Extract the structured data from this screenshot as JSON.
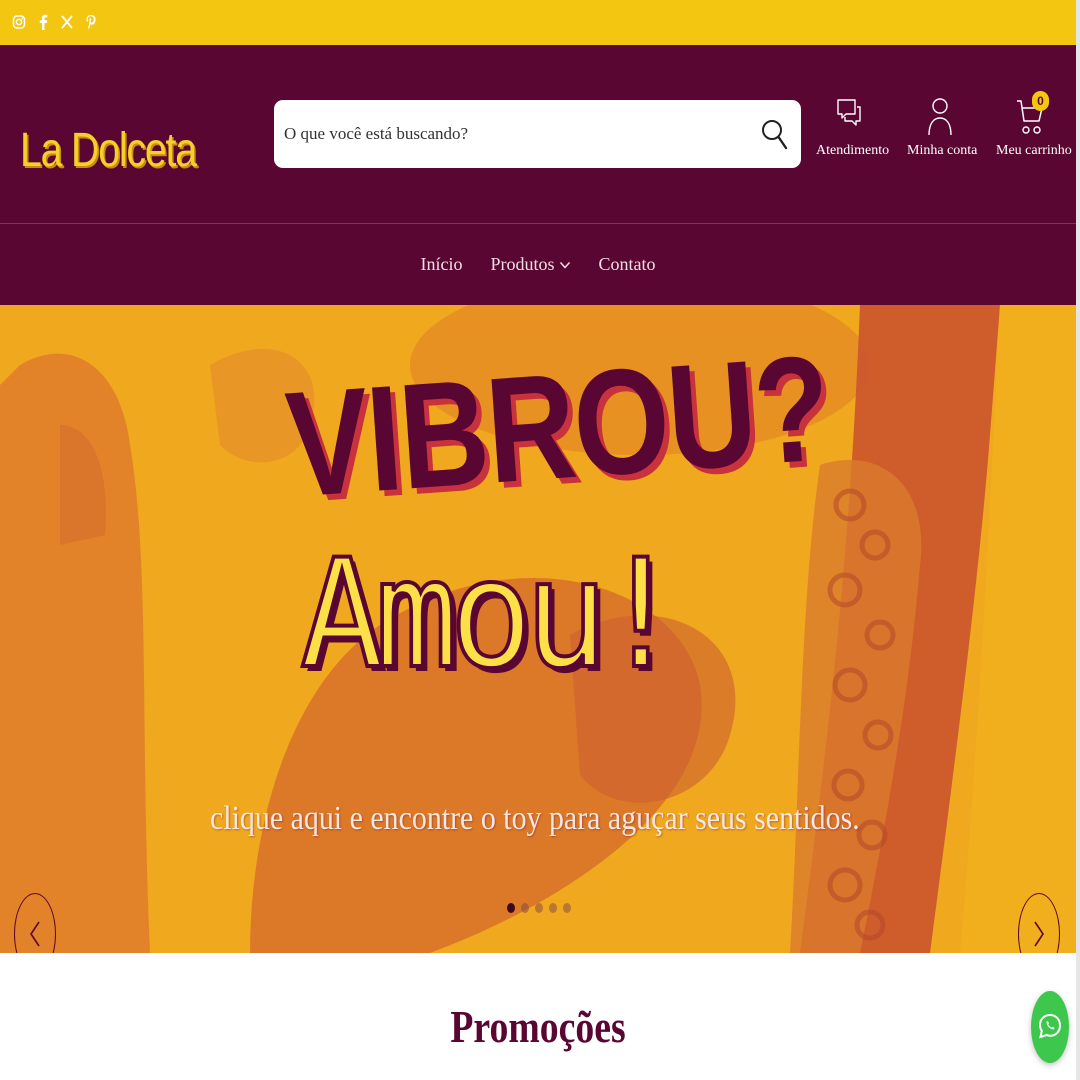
{
  "topbar": {
    "background": "#f2c611",
    "social_icons": [
      "instagram-icon",
      "facebook-icon",
      "x-icon",
      "pinterest-icon"
    ]
  },
  "header": {
    "logo": "La Dolceta",
    "brand_color": "#5a0632",
    "accent_color": "#f2c611",
    "search": {
      "placeholder": "O que você está buscando?",
      "value": ""
    },
    "actions": [
      {
        "label": "Atendimento",
        "icon": "chat-icon"
      },
      {
        "label": "Minha conta",
        "icon": "user-icon"
      },
      {
        "label": "Meu carrinho",
        "icon": "cart-icon",
        "badge": "0"
      }
    ]
  },
  "nav": {
    "items": [
      {
        "label": "Início"
      },
      {
        "label": "Produtos",
        "has_dropdown": true
      },
      {
        "label": "Contato"
      }
    ]
  },
  "hero": {
    "title_line1": "VIBROU?",
    "title_line2": "Amou!",
    "subtitle": "clique aqui e encontre o toy para aguçar seus sentidos.",
    "slide_count": 5,
    "active_slide": 1
  },
  "sections": {
    "promo_title": "Promoções"
  },
  "floating": {
    "whatsapp_icon": "whatsapp-icon"
  }
}
